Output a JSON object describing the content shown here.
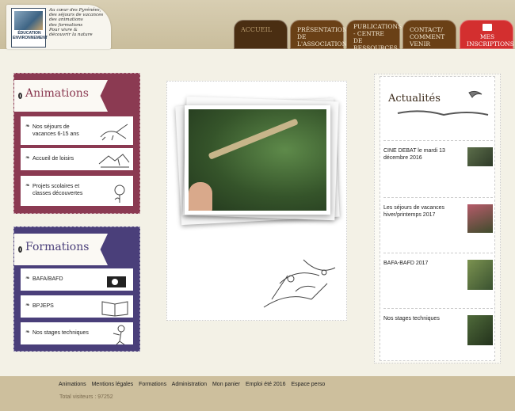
{
  "logo": {
    "caption": "ÉDUCATION ENVIRONNEMENT",
    "tagline": [
      "Au cœur des Pyrénées,",
      "des séjours de vacances",
      "des animations",
      "des formations",
      "Pour vivre &",
      "découvrir la nature"
    ]
  },
  "nav": {
    "tabs": [
      {
        "label": "ACCUEIL"
      },
      {
        "label": "PRÉSENTATION DE L'ASSOCIATION"
      },
      {
        "label": "PUBLICATIONS - CENTRE DE RESSOURCES"
      },
      {
        "label": "CONTACT/ COMMENT VENIR"
      },
      {
        "label": "MES INSCRIPTIONS"
      }
    ]
  },
  "animations": {
    "title": "Animations",
    "items": [
      {
        "label": "Nos séjours de vacances 6-15 ans"
      },
      {
        "label": "Accueil de loisirs"
      },
      {
        "label": "Projets scolaires et classes découvertes"
      }
    ]
  },
  "formations": {
    "title": "Formations",
    "items": [
      {
        "label": "BAFA/BAFD"
      },
      {
        "label": "BPJEPS"
      },
      {
        "label": "Nos stages techniques"
      }
    ]
  },
  "news": {
    "title": "Actualités",
    "items": [
      {
        "text": "CINE DEBAT le mardi 13 décembre 2016"
      },
      {
        "text": "Les séjours de vacances hiver/printemps 2017"
      },
      {
        "text": "BAFA-BAFD 2017"
      },
      {
        "text": "Nos stages techniques"
      }
    ]
  },
  "footer": {
    "links": [
      "Animations",
      "Mentions légales",
      "Formations",
      "Administration",
      "Mon panier",
      "Emploi été 2016",
      "Espace perso"
    ],
    "visitors": "Total visiteurs : 97252"
  },
  "colors": {
    "animations": "#8b3a52",
    "formations": "#4a3f7a",
    "nav_brown": "#6a4016",
    "nav_red": "#d32f2f"
  }
}
